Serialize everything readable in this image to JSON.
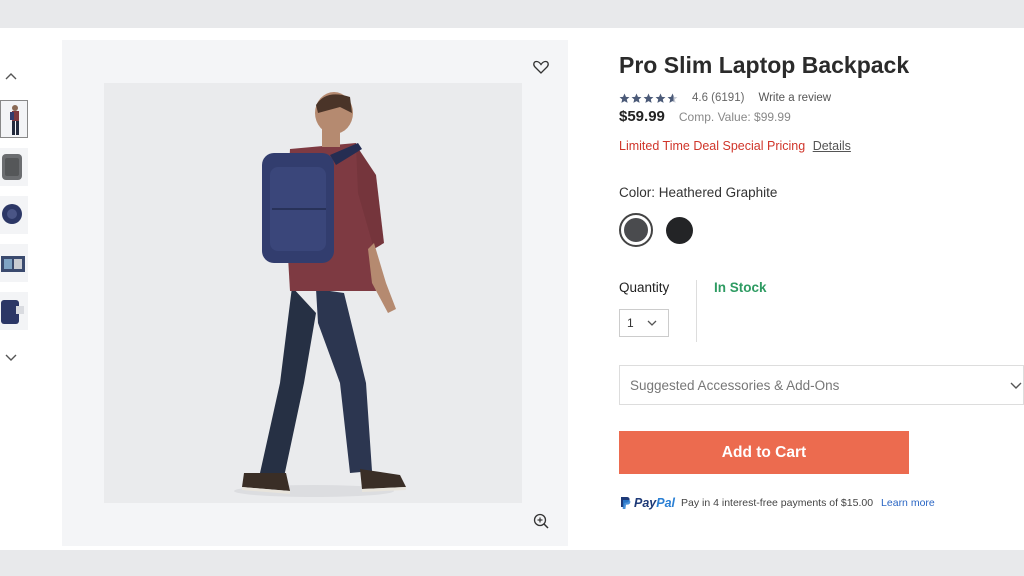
{
  "product": {
    "title": "Pro Slim Laptop Backpack",
    "rating_value": 4.6,
    "rating_text": "4.6 (6191)",
    "write_review": "Write a review",
    "price": "$59.99",
    "comp_value": "Comp. Value: $99.99",
    "deal_text": "Limited Time Deal Special Pricing",
    "deal_link": "Details"
  },
  "color": {
    "label": "Color:",
    "selected": "Heathered Graphite",
    "swatches": [
      {
        "name": "Heathered Graphite",
        "hex": "#4a4b4e",
        "selected": true
      },
      {
        "name": "Black",
        "hex": "#232426",
        "selected": false
      }
    ]
  },
  "quantity": {
    "label": "Quantity",
    "value": "1",
    "stock_status": "In Stock"
  },
  "accessories": {
    "label": "Suggested Accessories & Add-Ons"
  },
  "cart": {
    "button_label": "Add to Cart"
  },
  "paypal": {
    "logo_pay": "Pay",
    "logo_pal": "Pal",
    "installments": "Pay in 4 interest-free payments of $15.00",
    "learn_more": "Learn more"
  },
  "icons": {
    "wishlist": "heart-icon",
    "zoom": "zoom-in-icon",
    "thumb_up": "chevron-up-icon",
    "thumb_down": "chevron-down-icon"
  },
  "colors": {
    "accent_button": "#ec6b4f",
    "deal_red": "#d0352a",
    "stock_green": "#2e9b62",
    "backpack_navy": "#323d6e"
  }
}
